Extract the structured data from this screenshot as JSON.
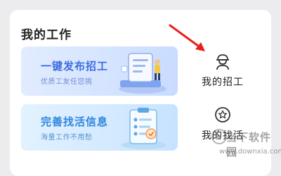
{
  "my_work": {
    "title": "我的工作",
    "banners": [
      {
        "title": "一键发布招工",
        "subtitle": "优质工友任您挑"
      },
      {
        "title": "完善找活信息",
        "subtitle": "海量工作不用愁"
      }
    ],
    "side_items": [
      {
        "label": "我的招工",
        "icon": "worker-helmet-icon"
      },
      {
        "label": "我的找活",
        "icon": "star-badge-icon"
      }
    ]
  },
  "watermark": {
    "text": "当下软件园",
    "url": "www.downxia.com"
  },
  "colors": {
    "annotation_arrow": "#e8201a",
    "banner_primary": "#3c6de0",
    "banner_secondary": "#2e86dc"
  }
}
